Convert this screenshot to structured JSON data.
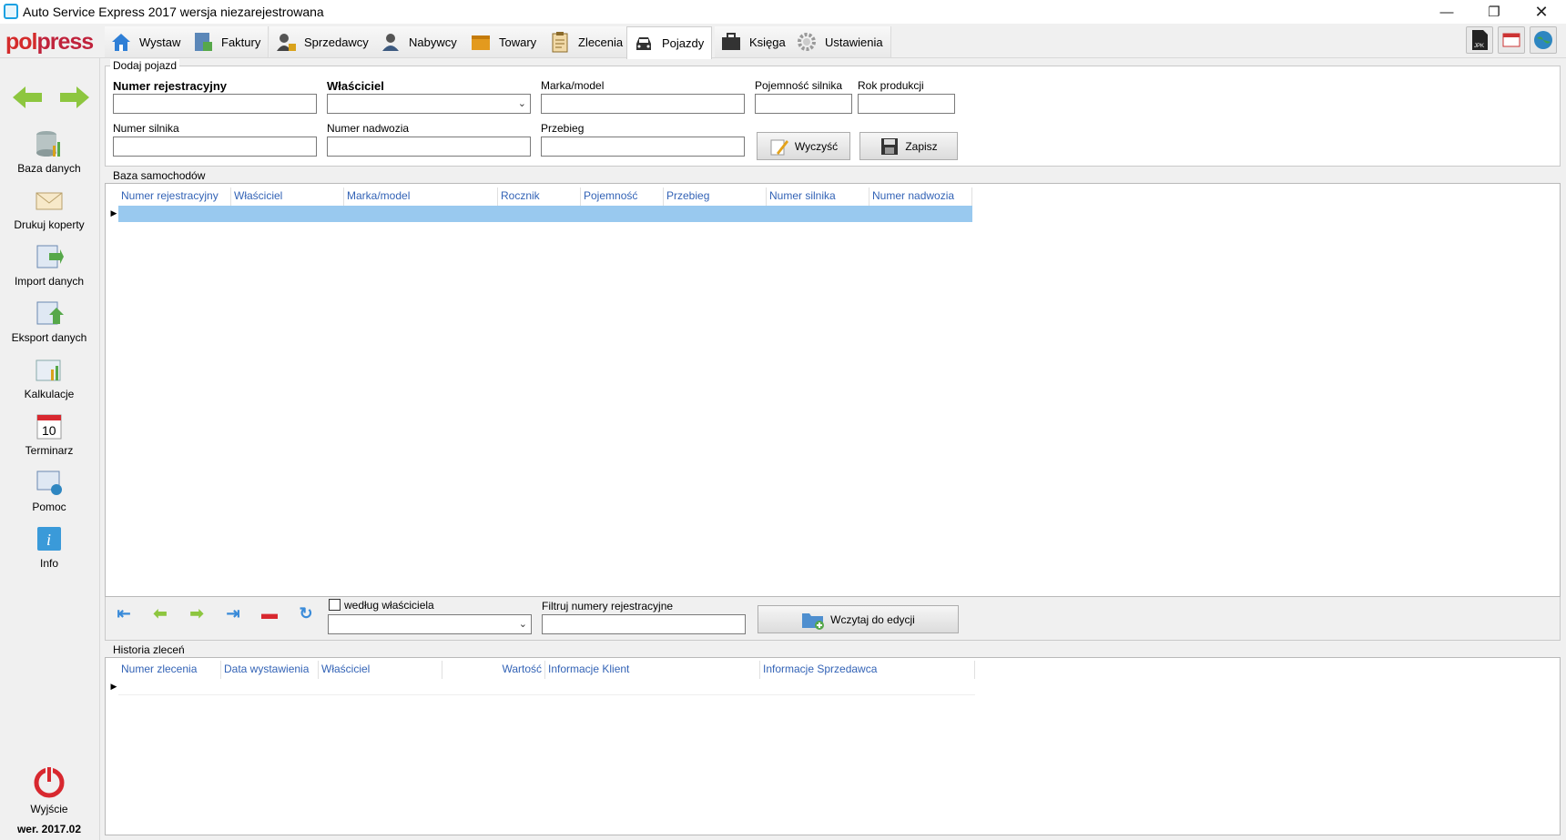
{
  "window": {
    "title": "Auto Service Express 2017 wersja niezarejestrowana",
    "controls": [
      "minimize",
      "restore",
      "close"
    ]
  },
  "logo": {
    "part1": "pol",
    "part2": "press"
  },
  "tabs": [
    {
      "label": "Wystaw",
      "icon": "home-icon"
    },
    {
      "label": "Faktury",
      "icon": "invoice-icon"
    },
    {
      "label": "Sprzedawcy",
      "icon": "seller-icon"
    },
    {
      "label": "Nabywcy",
      "icon": "buyer-icon"
    },
    {
      "label": "Towary",
      "icon": "goods-icon"
    },
    {
      "label": "Zlecenia",
      "icon": "clipboard-icon"
    },
    {
      "label": "Pojazdy",
      "icon": "car-icon",
      "active": true
    },
    {
      "label": "Księga",
      "icon": "briefcase-icon"
    },
    {
      "label": "Ustawienia",
      "icon": "gear-icon"
    }
  ],
  "toolbar_right": [
    {
      "icon": "jpk-file-icon",
      "label": "JPK"
    },
    {
      "icon": "calendar-mail-icon"
    },
    {
      "icon": "globe-icon"
    }
  ],
  "sidebar": {
    "items": [
      {
        "label": "Baza danych",
        "icon": "database-icon"
      },
      {
        "label": "Drukuj koperty",
        "icon": "envelope-icon"
      },
      {
        "label": "Import danych",
        "icon": "import-icon"
      },
      {
        "label": "Eksport danych",
        "icon": "export-icon"
      },
      {
        "label": "Kalkulacje",
        "icon": "calculator-icon"
      },
      {
        "label": "Terminarz",
        "icon": "calendar-icon",
        "number": "10"
      },
      {
        "label": "Pomoc",
        "icon": "help-icon"
      },
      {
        "label": "Info",
        "icon": "info-icon",
        "glyph": "i"
      }
    ],
    "exit_label": "Wyjście",
    "version": "wer. 2017.02"
  },
  "add_vehicle": {
    "title": "Dodaj pojazd",
    "registration_label": "Numer rejestracyjny",
    "owner_label": "Właściciel",
    "make_model_label": "Marka/model",
    "engine_capacity_label": "Pojemność silnika",
    "production_year_label": "Rok produkcji",
    "engine_number_label": "Numer silnika",
    "body_number_label": "Numer nadwozia",
    "mileage_label": "Przebieg",
    "clear_button": "Wyczyść",
    "save_button": "Zapisz"
  },
  "cars_db": {
    "title": "Baza samochodów",
    "columns": [
      "Numer rejestracyjny",
      "Właściciel",
      "Marka/model",
      "Rocznik",
      "Pojemność",
      "Przebieg",
      "Numer silnika",
      "Numer nadwozia"
    ],
    "selected_row_color": "#99c9ef",
    "by_owner_label": "według właściciela",
    "filter_label": "Filtruj numery rejestracyjne",
    "load_button": "Wczytaj do edycji"
  },
  "orders_history": {
    "title": "Historia zleceń",
    "columns": [
      "Numer zlecenia",
      "Data wystawienia",
      "Właściciel",
      "Wartość",
      "Informacje Klient",
      "Informacje Sprzedawca"
    ]
  },
  "colors": {
    "accent_blue": "#3363b6",
    "nav_green": "#8dc63f",
    "exit_red": "#d8282f"
  }
}
